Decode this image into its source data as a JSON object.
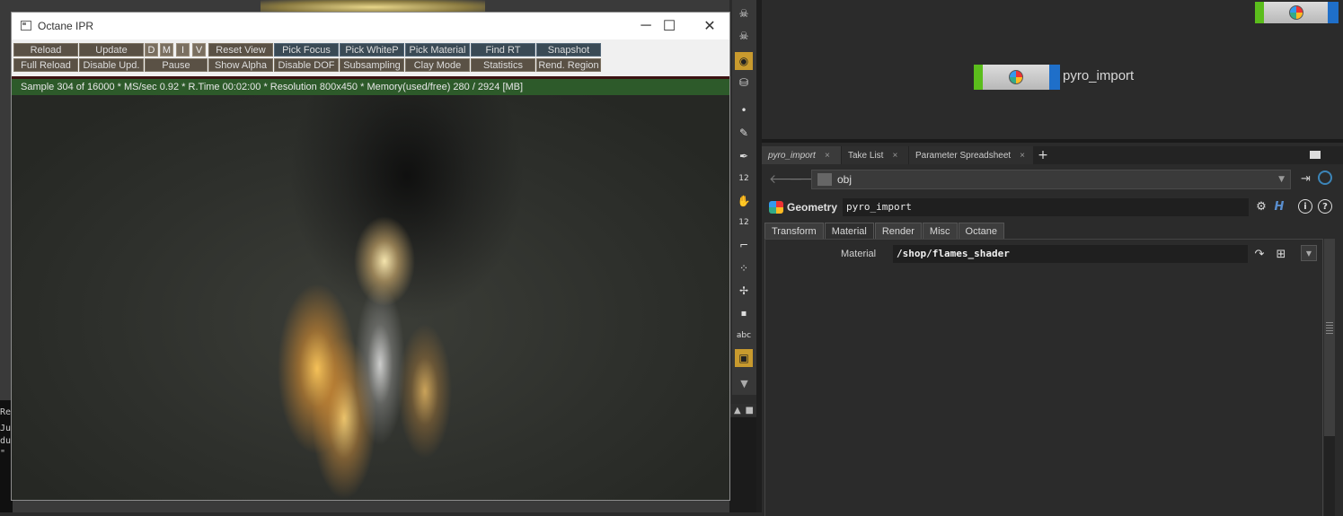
{
  "ipr_window": {
    "title": "Octane IPR",
    "controls": {
      "minimize": "─",
      "maximize": "☐",
      "close": "✕"
    },
    "toolbar_row1": [
      "Reload",
      "Update",
      "D",
      "M",
      "I",
      "V",
      "Reset View",
      "Pick Focus",
      "Pick WhiteP",
      "Pick Material",
      "Find RT",
      "Snapshot"
    ],
    "toolbar_row2": [
      "Full Reload",
      "Disable Upd.",
      "Pause",
      "Show Alpha",
      "Disable DOF",
      "Subsampling",
      "Clay Mode",
      "Statistics",
      "Rend. Region"
    ],
    "status": "Sample 304 of 16000 * MS/sec 0.92 * R.Time 00:02:00 * Resolution 800x450 * Memory(used/free) 280 / 2924 [MB]"
  },
  "background_console": {
    "lines": [
      "Ren",
      "Ju",
      "du",
      "\""
    ]
  },
  "shelf": {
    "icons": [
      "skull-icon",
      "skull-icon",
      "render-globe-icon",
      "paint-bucket-icon",
      "dot-icon",
      "brush-icon",
      "pen-icon",
      "numbered-point-icon",
      "hand-icon",
      "numbered-point-icon",
      "curve-icon",
      "scatter-icon",
      "transform-icon",
      "stop-icon",
      "text-icon",
      "image-icon"
    ],
    "labels": {
      "numbered_1": "12",
      "numbered_2": "12",
      "text": "abc"
    },
    "scroll_down": "▼"
  },
  "left_mini": {
    "arrow": "▲",
    "square": "■"
  },
  "network": {
    "node_name": "pyro_import"
  },
  "param_pane": {
    "tabs": [
      {
        "label": "pyro_import",
        "close": "×"
      },
      {
        "label": "Take List",
        "close": "×"
      },
      {
        "label": "Parameter Spreadsheet",
        "close": "×"
      }
    ],
    "add_tab": "+",
    "path": "obj",
    "back": "🡐",
    "forward": "🡒",
    "node_type": "Geometry",
    "node_name": "pyro_import",
    "header_icons": {
      "gear": "⚙",
      "help": "H",
      "info": "i",
      "question": "?"
    },
    "folder_tabs": [
      "Transform",
      "Material",
      "Render",
      "Misc",
      "Octane"
    ],
    "active_folder": "Material",
    "material_label": "Material",
    "material_value": "/shop/flames_shader",
    "dropdown": "▼"
  }
}
